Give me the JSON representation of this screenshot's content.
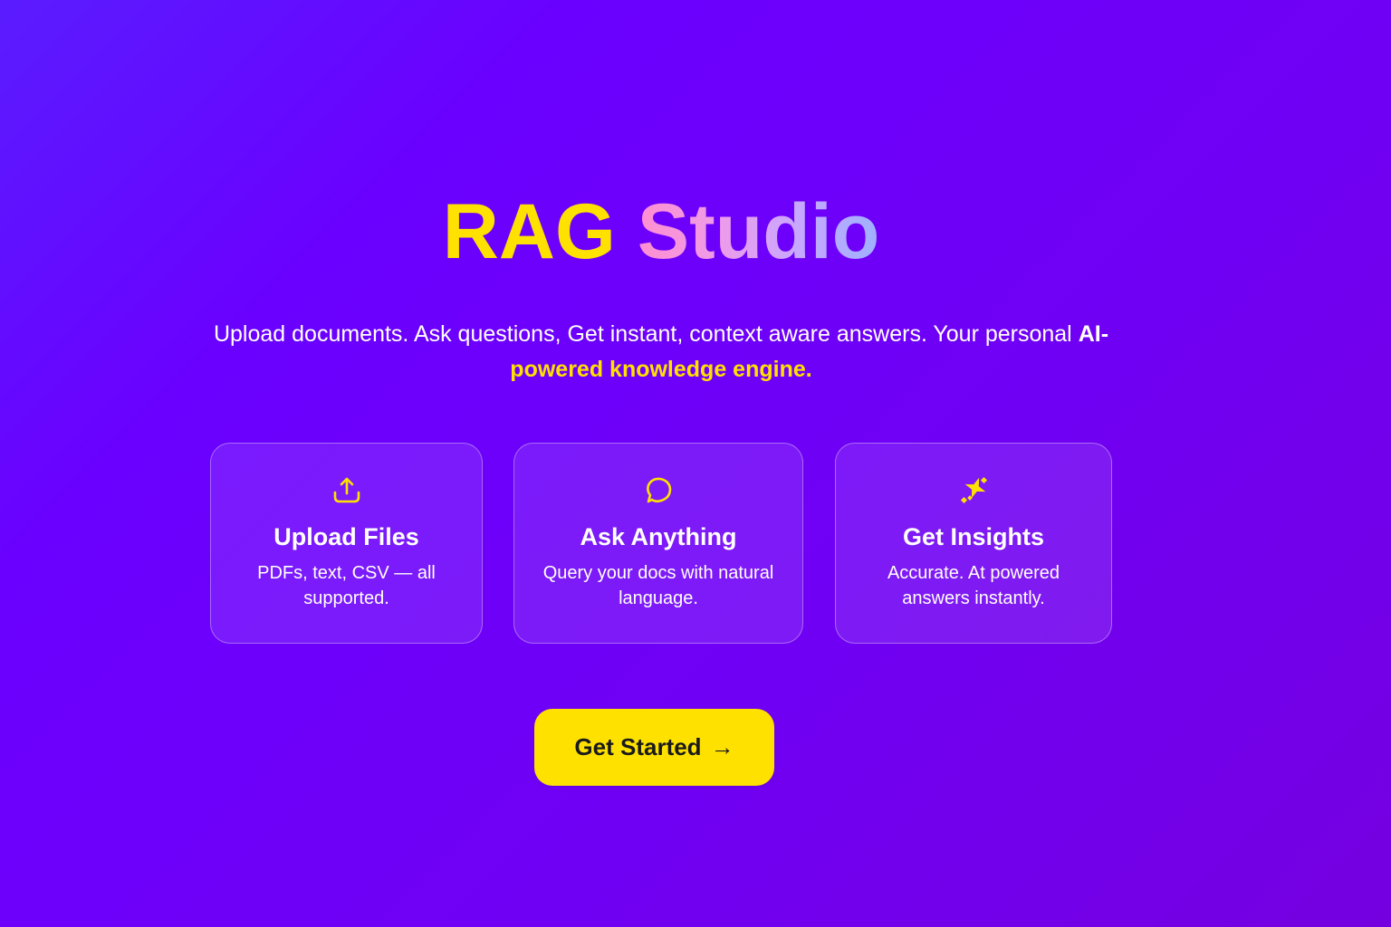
{
  "hero": {
    "title_part1": "RAG",
    "title_part2": "Studio",
    "subtitle_text": "Upload documents. Ask questions, Get instant, context aware answers. Your personal ",
    "subtitle_strong_white": "AI-",
    "subtitle_strong_yellow": "powered knowledge engine."
  },
  "features": [
    {
      "icon": "upload-icon",
      "title": "Upload Files",
      "description": "PDFs, text, CSV — all supported."
    },
    {
      "icon": "chat-bubble-icon",
      "title": "Ask Anything",
      "description": "Query your docs with natural language."
    },
    {
      "icon": "sparkle-icon",
      "title": "Get Insights",
      "description": "Accurate. At powered answers instantly."
    }
  ],
  "cta": {
    "label": "Get Started",
    "arrow": "→"
  },
  "colors": {
    "accent": "#ffe100",
    "background_start": "#5a1cff",
    "background_end": "#7400e0"
  }
}
